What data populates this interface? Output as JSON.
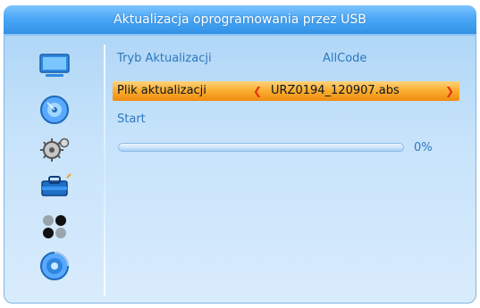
{
  "window": {
    "title": "Aktualizacja oprogramowania przez USB"
  },
  "sidebar": {
    "items": [
      {
        "icon": "tv-icon"
      },
      {
        "icon": "disc-icon"
      },
      {
        "icon": "gear-icon"
      },
      {
        "icon": "toolbox-icon"
      },
      {
        "icon": "dots-icon"
      },
      {
        "icon": "satellite-icon"
      }
    ]
  },
  "form": {
    "mode": {
      "label": "Tryb Aktualizacji",
      "value": "AllCode"
    },
    "file": {
      "label": "Plik aktualizacji",
      "value": "URZ0194_120907.abs"
    },
    "start": {
      "label": "Start"
    },
    "progress": {
      "percent_text": "0%",
      "value": 0
    }
  },
  "colors": {
    "title_bar": "#4aa7f6",
    "highlight": "#f9ac2e",
    "text": "#2d78bf",
    "arrow": "#e63214"
  }
}
